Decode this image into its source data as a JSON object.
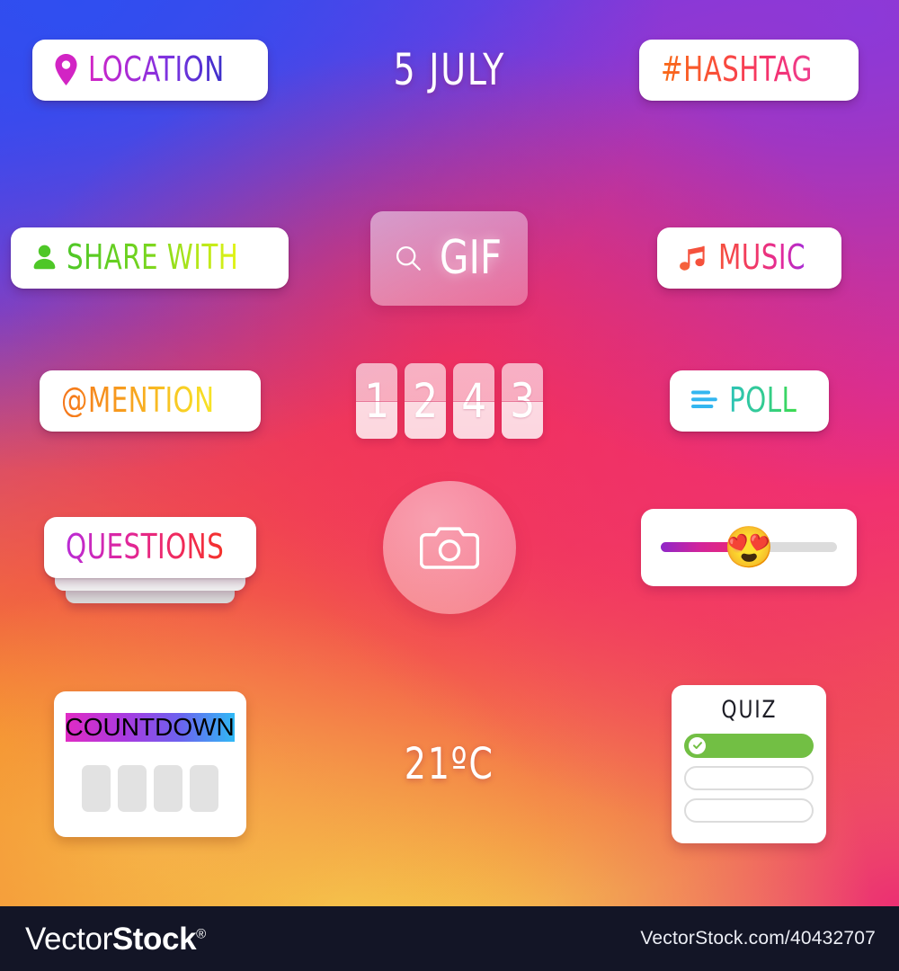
{
  "stickers": {
    "location": {
      "label": "LOCATION",
      "icon": "map-pin-icon"
    },
    "date": {
      "label": "5 JULY"
    },
    "hashtag": {
      "label": "#HASHTAG"
    },
    "share_with": {
      "label": "SHARE WITH",
      "icon": "person-icon"
    },
    "gif": {
      "label": "GIF",
      "icon": "search-icon"
    },
    "music": {
      "label": "MUSIC",
      "icon": "music-note-icon"
    },
    "mention": {
      "label": "@MENTION"
    },
    "counter": {
      "digits": [
        "1",
        "2",
        "4",
        "3"
      ]
    },
    "poll": {
      "label": "POLL",
      "icon": "poll-bars-icon"
    },
    "questions": {
      "label": "QUESTIONS"
    },
    "camera": {
      "icon": "camera-icon"
    },
    "slider": {
      "emoji": "😍",
      "fill_percent": 50
    },
    "countdown": {
      "label": "COUNTDOWN",
      "boxes": 4
    },
    "temperature": {
      "label": "21ºC"
    },
    "quiz": {
      "title": "QUIZ",
      "options": [
        {
          "state": "correct",
          "label": ""
        },
        {
          "state": "empty",
          "label": ""
        },
        {
          "state": "empty",
          "label": ""
        }
      ]
    }
  },
  "footer": {
    "logo_light": "Vector",
    "logo_bold": "Stock",
    "registered": "®",
    "url": "VectorStock.com/40432707"
  },
  "colors": {
    "quiz_correct": "#72bf44",
    "slider_fill_start": "#8f27c9",
    "slider_fill_end": "#ef2a6c",
    "footer_bg": "#131526"
  }
}
